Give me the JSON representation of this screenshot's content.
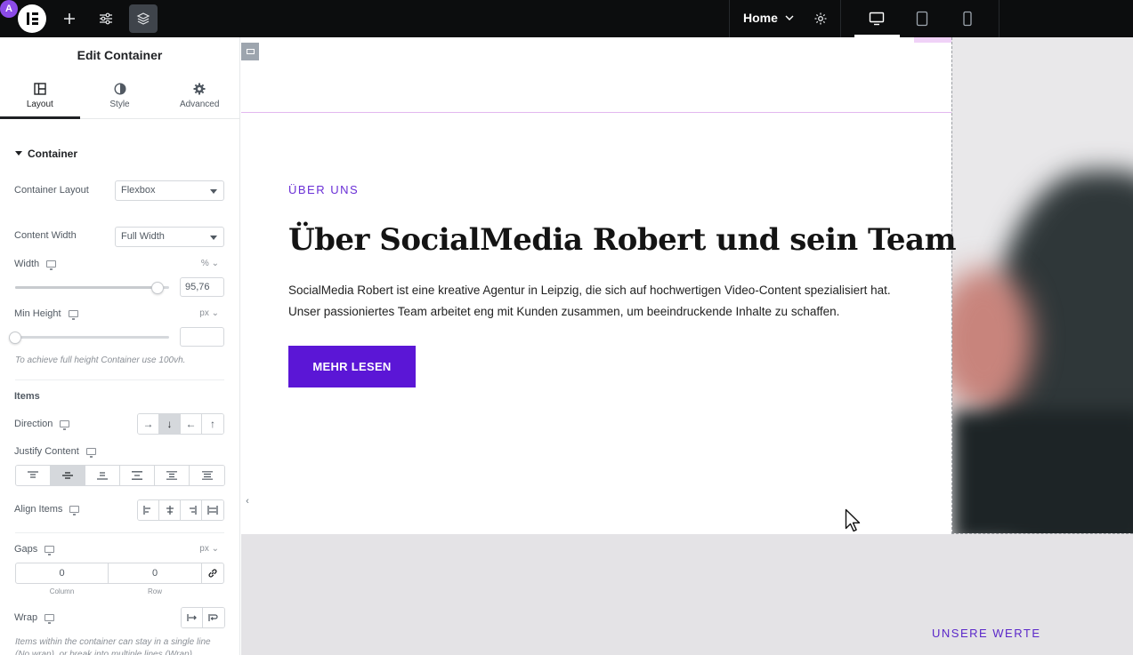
{
  "topbar": {
    "page_selector": "Home",
    "colors": {
      "bar": "#0c0d0e",
      "ai": "#8c4be8"
    }
  },
  "panel": {
    "title": "Edit Container",
    "tabs": [
      {
        "label": "Layout",
        "icon": "layout-icon"
      },
      {
        "label": "Style",
        "icon": "contrast-icon"
      },
      {
        "label": "Advanced",
        "icon": "gear-icon"
      }
    ],
    "section_container": "Container",
    "container_layout": {
      "label": "Container Layout",
      "value": "Flexbox"
    },
    "content_width": {
      "label": "Content Width",
      "value": "Full Width"
    },
    "width": {
      "label": "Width",
      "unit": "%",
      "value": "95,76",
      "slider_fraction": 0.96
    },
    "min_height": {
      "label": "Min Height",
      "unit": "px",
      "value": "",
      "slider_fraction": 0
    },
    "min_height_hint": "To achieve full height Container use 100vh.",
    "items_heading": "Items",
    "direction": {
      "label": "Direction",
      "options": [
        "→",
        "↓",
        "←",
        "↑"
      ],
      "active_index": 1
    },
    "justify_content": {
      "label": "Justify Content",
      "active_index": 1
    },
    "align_items": {
      "label": "Align Items"
    },
    "gaps": {
      "label": "Gaps",
      "unit": "px",
      "column": "0",
      "row": "0",
      "column_label": "Column",
      "row_label": "Row"
    },
    "wrap": {
      "label": "Wrap"
    },
    "wrap_hint": "Items within the container can stay in a single line (No wrap), or break into multiple lines (Wrap)."
  },
  "canvas": {
    "eyebrow": "ÜBER UNS",
    "headline": "Über SocialMedia Robert und sein Team",
    "body_line1": "SocialMedia Robert ist eine kreative Agentur in Leipzig, die sich auf hochwertigen Video-Content spezialisiert hat.",
    "body_line2": "Unser passioniertes Team arbeitet eng mit Kunden zusammen, um beeindruckende Inhalte zu schaffen.",
    "cta_label": "MEHR LESEN",
    "section2_eyebrow": "UNSERE WERTE",
    "colors": {
      "accent": "#5b16d6",
      "eyebrow": "#6a2fd6"
    }
  }
}
